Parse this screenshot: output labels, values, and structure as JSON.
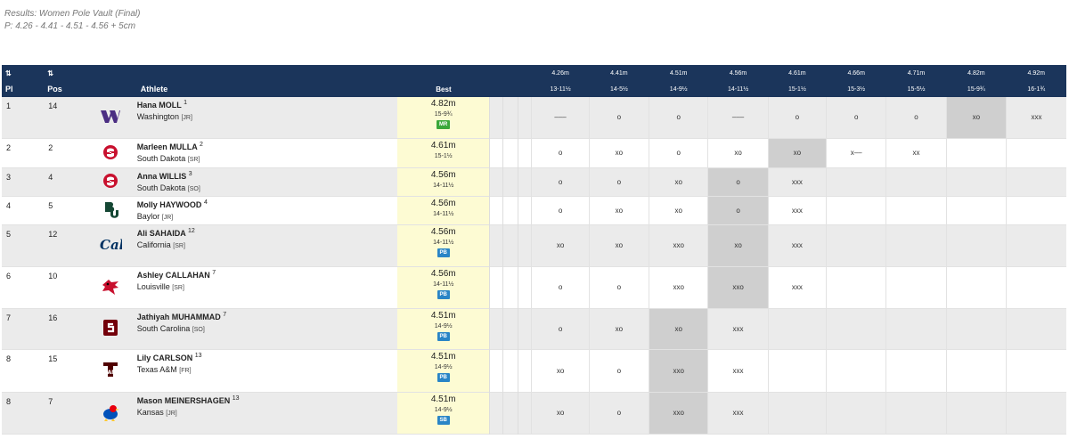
{
  "page": {
    "title": "Results: Women Pole Vault (Final)",
    "subtitle": "P: 4.26 - 4.41 - 4.51 - 4.56 + 5cm"
  },
  "header": {
    "sort_icon": "⇅",
    "pl": "Pl",
    "pos": "Pos",
    "athlete": "Athlete",
    "best": "Best",
    "heights": [
      {
        "m": "4.26m",
        "i": "13-11½"
      },
      {
        "m": "4.41m",
        "i": "14-5½"
      },
      {
        "m": "4.51m",
        "i": "14-9½"
      },
      {
        "m": "4.56m",
        "i": "14-11½"
      },
      {
        "m": "4.61m",
        "i": "15-1½"
      },
      {
        "m": "4.66m",
        "i": "15-3½"
      },
      {
        "m": "4.71m",
        "i": "15-5½"
      },
      {
        "m": "4.82m",
        "i": "15-9¾"
      },
      {
        "m": "4.92m",
        "i": "16-1¾"
      }
    ]
  },
  "colors": {
    "header_bg": "#1b355b",
    "best_bg": "#fdfbd3",
    "highlight": "#cfcfcf",
    "badge_mr": "#3aa73a",
    "badge_pb": "#2a85c6",
    "badge_sb": "#2a85c6"
  },
  "rows": [
    {
      "pl": "1",
      "pos": "14",
      "logo": "washington-logo",
      "name": "Hana MOLL",
      "sup": "1",
      "team": "Washington",
      "yr": "[JR]",
      "best": "4.82m",
      "best_imp": "15-9¾",
      "badge": "MR",
      "attempts": [
        "–––",
        "o",
        "o",
        "–––",
        "o",
        "o",
        "o",
        "xo",
        "xxx"
      ],
      "hl": 7
    },
    {
      "pl": "2",
      "pos": "2",
      "logo": "south-dakota-logo",
      "name": "Marleen MULLA",
      "sup": "2",
      "team": "South Dakota",
      "yr": "[SR]",
      "best": "4.61m",
      "best_imp": "15-1½",
      "badge": "",
      "attempts": [
        "o",
        "xo",
        "o",
        "xo",
        "xo",
        "x––",
        "xx",
        "",
        ""
      ],
      "hl": 4
    },
    {
      "pl": "3",
      "pos": "4",
      "logo": "south-dakota-logo",
      "name": "Anna WILLIS",
      "sup": "3",
      "team": "South Dakota",
      "yr": "[SO]",
      "best": "4.56m",
      "best_imp": "14-11½",
      "badge": "",
      "attempts": [
        "o",
        "o",
        "xo",
        "o",
        "xxx",
        "",
        "",
        "",
        ""
      ],
      "hl": 3
    },
    {
      "pl": "4",
      "pos": "5",
      "logo": "baylor-logo",
      "name": "Molly HAYWOOD",
      "sup": "4",
      "team": "Baylor",
      "yr": "[JR]",
      "best": "4.56m",
      "best_imp": "14-11½",
      "badge": "",
      "attempts": [
        "o",
        "xo",
        "xo",
        "o",
        "xxx",
        "",
        "",
        "",
        ""
      ],
      "hl": 3
    },
    {
      "pl": "5",
      "pos": "12",
      "logo": "california-logo",
      "name": "Ali SAHAIDA",
      "sup": "12",
      "team": "California",
      "yr": "[SR]",
      "best": "4.56m",
      "best_imp": "14-11½",
      "badge": "PB",
      "attempts": [
        "xo",
        "xo",
        "xxo",
        "xo",
        "xxx",
        "",
        "",
        "",
        ""
      ],
      "hl": 3
    },
    {
      "pl": "6",
      "pos": "10",
      "logo": "louisville-logo",
      "name": "Ashley CALLAHAN",
      "sup": "7",
      "team": "Louisville",
      "yr": "[SR]",
      "best": "4.56m",
      "best_imp": "14-11½",
      "badge": "PB",
      "attempts": [
        "o",
        "o",
        "xxo",
        "xxo",
        "xxx",
        "",
        "",
        "",
        ""
      ],
      "hl": 3
    },
    {
      "pl": "7",
      "pos": "16",
      "logo": "south-carolina-logo",
      "name": "Jathiyah MUHAMMAD",
      "sup": "7",
      "team": "South Carolina",
      "yr": "[SO]",
      "best": "4.51m",
      "best_imp": "14-9½",
      "badge": "PB",
      "attempts": [
        "o",
        "xo",
        "xo",
        "xxx",
        "",
        "",
        "",
        "",
        ""
      ],
      "hl": 2
    },
    {
      "pl": "8",
      "pos": "15",
      "logo": "texas-am-logo",
      "name": "Lily CARLSON",
      "sup": "13",
      "team": "Texas A&M",
      "yr": "[FR]",
      "best": "4.51m",
      "best_imp": "14-9½",
      "badge": "PB",
      "attempts": [
        "xo",
        "o",
        "xxo",
        "xxx",
        "",
        "",
        "",
        "",
        ""
      ],
      "hl": 2
    },
    {
      "pl": "8",
      "pos": "7",
      "logo": "kansas-logo",
      "name": "Mason MEINERSHAGEN",
      "sup": "13",
      "team": "Kansas",
      "yr": "[JR]",
      "best": "4.51m",
      "best_imp": "14-9½",
      "badge": "SB",
      "attempts": [
        "xo",
        "o",
        "xxo",
        "xxx",
        "",
        "",
        "",
        "",
        ""
      ],
      "hl": 2
    }
  ]
}
